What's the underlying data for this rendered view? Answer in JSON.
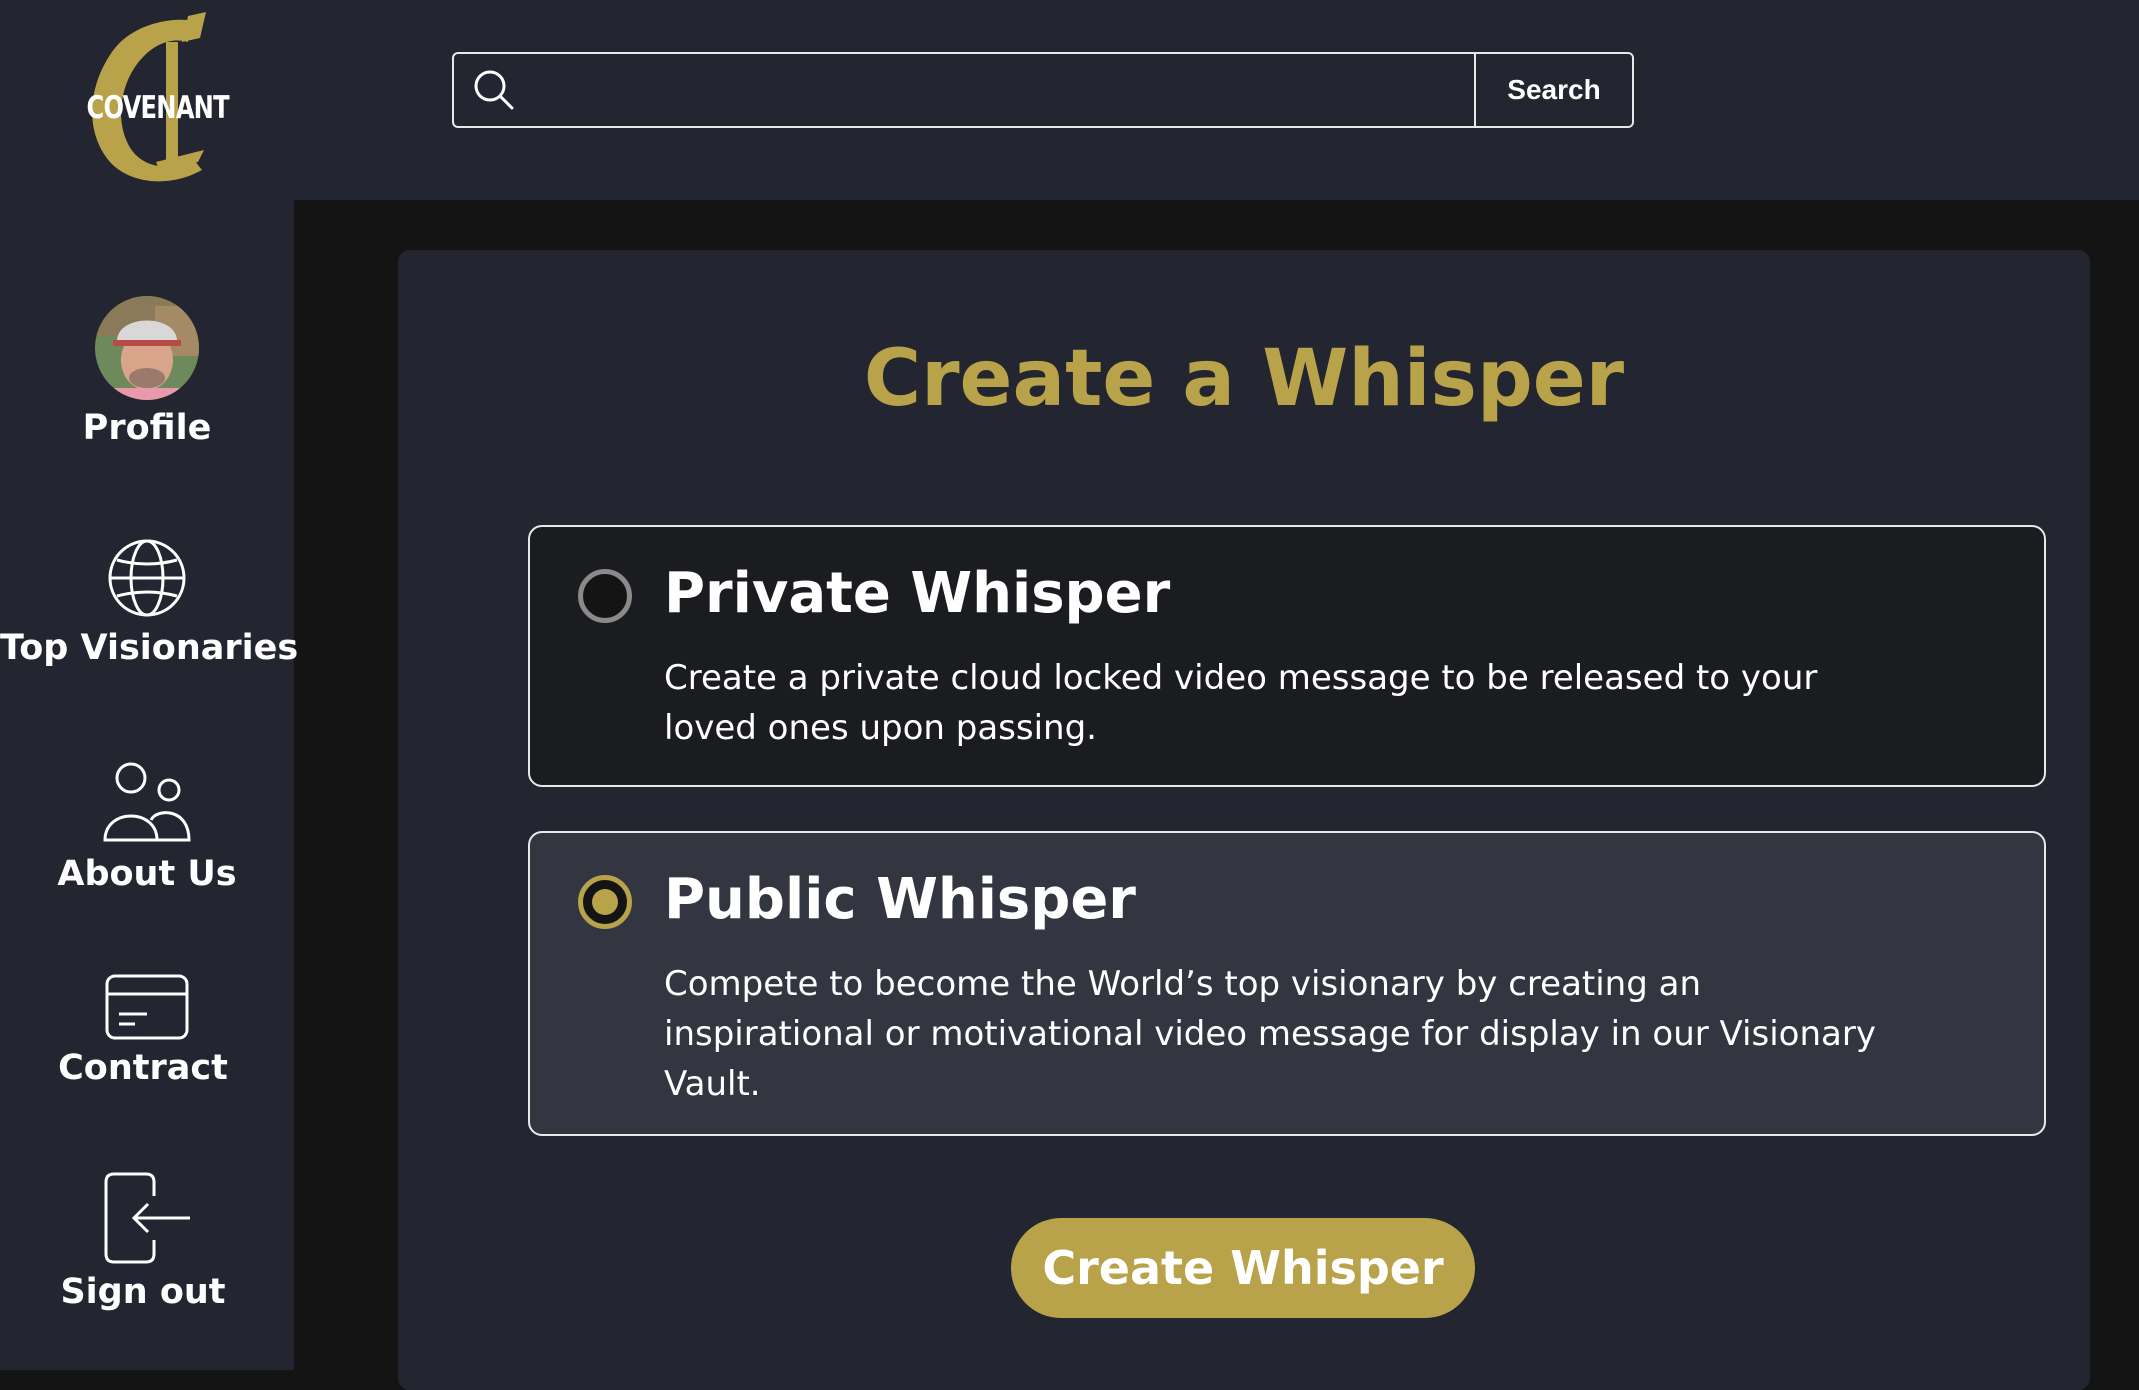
{
  "brand": {
    "logo_text": "COVENANT",
    "gold": "#b8a24a",
    "surface": "#232630",
    "backdrop": "#141414"
  },
  "search": {
    "placeholder": "",
    "value": "",
    "button_label": "Search",
    "icon": "search-icon"
  },
  "sidebar": {
    "items": [
      {
        "label": "Profile",
        "icon": "avatar"
      },
      {
        "label": "Top Visionaries",
        "icon": "globe-icon"
      },
      {
        "label": "About Us",
        "icon": "people-icon"
      },
      {
        "label": "Contract",
        "icon": "credit-card-icon"
      },
      {
        "label": "Sign out",
        "icon": "sign-out-icon"
      }
    ]
  },
  "main": {
    "title": "Create a Whisper",
    "options": [
      {
        "title": "Private Whisper",
        "description": "Create a private cloud locked video message to be released to your loved ones upon passing.",
        "selected": false
      },
      {
        "title": "Public Whisper",
        "description": "Compete to become the World’s top visionary by creating an inspirational or motivational video message for display in our Visionary Vault.",
        "selected": true
      }
    ],
    "submit_label": "Create Whisper"
  }
}
